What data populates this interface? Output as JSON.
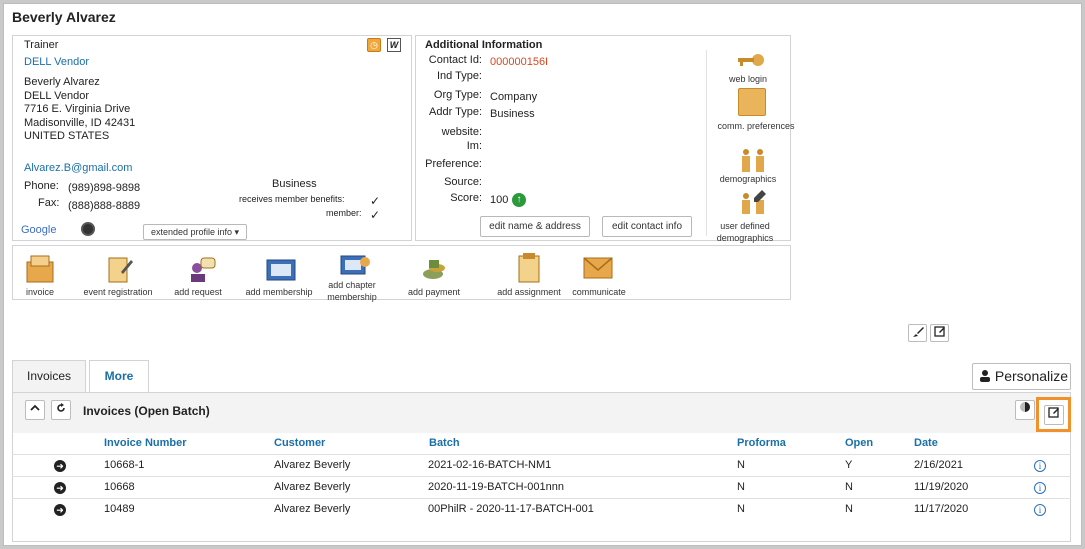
{
  "header": {
    "title": "Beverly Alvarez"
  },
  "contact": {
    "role": "Trainer",
    "company_link": "DELL Vendor",
    "address_lines": [
      "Beverly Alvarez",
      "DELL Vendor",
      "7716 E. Virginia Drive",
      "Madisonville, ID 42431",
      "UNITED STATES"
    ],
    "email": "Alvarez.B@gmail.com",
    "phone_label": "Phone:",
    "phone": "(989)898-9898",
    "fax_label": "Fax:",
    "fax": "(888)888-8889",
    "type": "Business",
    "benefits_label": "receives member benefits:",
    "member_label": "member:",
    "check": "✓",
    "google_label": "Google",
    "extended_label": "extended profile info"
  },
  "additional": {
    "title": "Additional Information",
    "fields": [
      {
        "label": "Contact Id:",
        "value": "000000156I"
      },
      {
        "label": "Ind Type:",
        "value": ""
      },
      {
        "label": "Org Type:",
        "value": "Company"
      },
      {
        "label": "Addr Type:",
        "value": "Business"
      },
      {
        "label": "website:",
        "value": ""
      },
      {
        "label": "Im:",
        "value": ""
      },
      {
        "label": "Preference:",
        "value": ""
      },
      {
        "label": "Source:",
        "value": ""
      },
      {
        "label": "Score:",
        "value": "100"
      }
    ],
    "edit_name_btn": "edit name & address",
    "edit_contact_btn": "edit contact info",
    "side": [
      "web login",
      "comm. preferences",
      "demographics",
      "user defined demographics"
    ]
  },
  "actions": [
    "invoice",
    "event registration",
    "add request",
    "add membership",
    "add chapter membership",
    "add payment",
    "add assignment",
    "communicate"
  ],
  "tabs": [
    "Invoices",
    "More"
  ],
  "personalize_label": "Personalize",
  "section_title": "Invoices (Open Batch)",
  "table": {
    "headers": [
      "Invoice Number",
      "Customer",
      "Batch",
      "Proforma",
      "Open",
      "Date"
    ],
    "rows": [
      {
        "invoice": "10668-1",
        "customer": "Alvarez Beverly",
        "batch": "2021-02-16-BATCH-NM1",
        "proforma": "N",
        "open": "Y",
        "date": "2/16/2021"
      },
      {
        "invoice": "10668",
        "customer": "Alvarez Beverly",
        "batch": "2020-11-19-BATCH-001nnn",
        "proforma": "N",
        "open": "N",
        "date": "11/19/2020"
      },
      {
        "invoice": "10489",
        "customer": "Alvarez Beverly",
        "batch": "00PhilR - 2020-11-17-BATCH-001",
        "proforma": "N",
        "open": "N",
        "date": "11/17/2020"
      }
    ]
  },
  "colors": {
    "accent": "#1a6fa8",
    "highlight": "#f0912b",
    "id_red": "#d9481f"
  }
}
